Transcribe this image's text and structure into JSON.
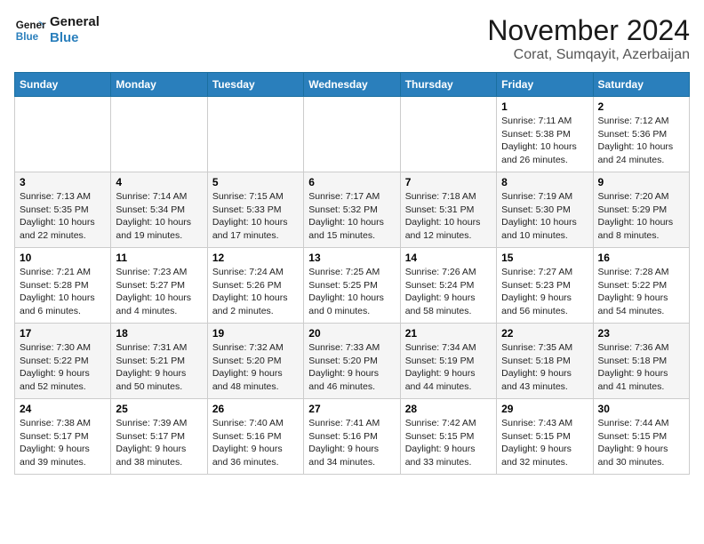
{
  "header": {
    "logo_line1": "General",
    "logo_line2": "Blue",
    "month_year": "November 2024",
    "location": "Corat, Sumqayit, Azerbaijan"
  },
  "days_of_week": [
    "Sunday",
    "Monday",
    "Tuesday",
    "Wednesday",
    "Thursday",
    "Friday",
    "Saturday"
  ],
  "weeks": [
    [
      {
        "day": "",
        "info": ""
      },
      {
        "day": "",
        "info": ""
      },
      {
        "day": "",
        "info": ""
      },
      {
        "day": "",
        "info": ""
      },
      {
        "day": "",
        "info": ""
      },
      {
        "day": "1",
        "info": "Sunrise: 7:11 AM\nSunset: 5:38 PM\nDaylight: 10 hours and 26 minutes."
      },
      {
        "day": "2",
        "info": "Sunrise: 7:12 AM\nSunset: 5:36 PM\nDaylight: 10 hours and 24 minutes."
      }
    ],
    [
      {
        "day": "3",
        "info": "Sunrise: 7:13 AM\nSunset: 5:35 PM\nDaylight: 10 hours and 22 minutes."
      },
      {
        "day": "4",
        "info": "Sunrise: 7:14 AM\nSunset: 5:34 PM\nDaylight: 10 hours and 19 minutes."
      },
      {
        "day": "5",
        "info": "Sunrise: 7:15 AM\nSunset: 5:33 PM\nDaylight: 10 hours and 17 minutes."
      },
      {
        "day": "6",
        "info": "Sunrise: 7:17 AM\nSunset: 5:32 PM\nDaylight: 10 hours and 15 minutes."
      },
      {
        "day": "7",
        "info": "Sunrise: 7:18 AM\nSunset: 5:31 PM\nDaylight: 10 hours and 12 minutes."
      },
      {
        "day": "8",
        "info": "Sunrise: 7:19 AM\nSunset: 5:30 PM\nDaylight: 10 hours and 10 minutes."
      },
      {
        "day": "9",
        "info": "Sunrise: 7:20 AM\nSunset: 5:29 PM\nDaylight: 10 hours and 8 minutes."
      }
    ],
    [
      {
        "day": "10",
        "info": "Sunrise: 7:21 AM\nSunset: 5:28 PM\nDaylight: 10 hours and 6 minutes."
      },
      {
        "day": "11",
        "info": "Sunrise: 7:23 AM\nSunset: 5:27 PM\nDaylight: 10 hours and 4 minutes."
      },
      {
        "day": "12",
        "info": "Sunrise: 7:24 AM\nSunset: 5:26 PM\nDaylight: 10 hours and 2 minutes."
      },
      {
        "day": "13",
        "info": "Sunrise: 7:25 AM\nSunset: 5:25 PM\nDaylight: 10 hours and 0 minutes."
      },
      {
        "day": "14",
        "info": "Sunrise: 7:26 AM\nSunset: 5:24 PM\nDaylight: 9 hours and 58 minutes."
      },
      {
        "day": "15",
        "info": "Sunrise: 7:27 AM\nSunset: 5:23 PM\nDaylight: 9 hours and 56 minutes."
      },
      {
        "day": "16",
        "info": "Sunrise: 7:28 AM\nSunset: 5:22 PM\nDaylight: 9 hours and 54 minutes."
      }
    ],
    [
      {
        "day": "17",
        "info": "Sunrise: 7:30 AM\nSunset: 5:22 PM\nDaylight: 9 hours and 52 minutes."
      },
      {
        "day": "18",
        "info": "Sunrise: 7:31 AM\nSunset: 5:21 PM\nDaylight: 9 hours and 50 minutes."
      },
      {
        "day": "19",
        "info": "Sunrise: 7:32 AM\nSunset: 5:20 PM\nDaylight: 9 hours and 48 minutes."
      },
      {
        "day": "20",
        "info": "Sunrise: 7:33 AM\nSunset: 5:20 PM\nDaylight: 9 hours and 46 minutes."
      },
      {
        "day": "21",
        "info": "Sunrise: 7:34 AM\nSunset: 5:19 PM\nDaylight: 9 hours and 44 minutes."
      },
      {
        "day": "22",
        "info": "Sunrise: 7:35 AM\nSunset: 5:18 PM\nDaylight: 9 hours and 43 minutes."
      },
      {
        "day": "23",
        "info": "Sunrise: 7:36 AM\nSunset: 5:18 PM\nDaylight: 9 hours and 41 minutes."
      }
    ],
    [
      {
        "day": "24",
        "info": "Sunrise: 7:38 AM\nSunset: 5:17 PM\nDaylight: 9 hours and 39 minutes."
      },
      {
        "day": "25",
        "info": "Sunrise: 7:39 AM\nSunset: 5:17 PM\nDaylight: 9 hours and 38 minutes."
      },
      {
        "day": "26",
        "info": "Sunrise: 7:40 AM\nSunset: 5:16 PM\nDaylight: 9 hours and 36 minutes."
      },
      {
        "day": "27",
        "info": "Sunrise: 7:41 AM\nSunset: 5:16 PM\nDaylight: 9 hours and 34 minutes."
      },
      {
        "day": "28",
        "info": "Sunrise: 7:42 AM\nSunset: 5:15 PM\nDaylight: 9 hours and 33 minutes."
      },
      {
        "day": "29",
        "info": "Sunrise: 7:43 AM\nSunset: 5:15 PM\nDaylight: 9 hours and 32 minutes."
      },
      {
        "day": "30",
        "info": "Sunrise: 7:44 AM\nSunset: 5:15 PM\nDaylight: 9 hours and 30 minutes."
      }
    ]
  ]
}
